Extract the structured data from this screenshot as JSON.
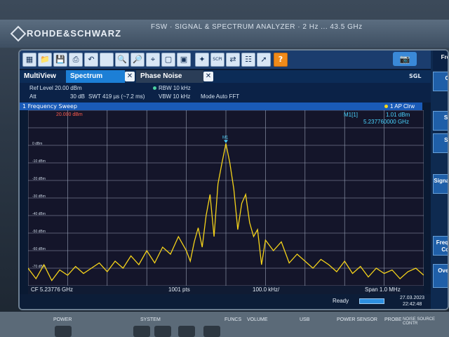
{
  "instrument": {
    "brand": "ROHDE&SCHWARZ",
    "model_line": "FSW · SIGNAL & SPECTRUM ANALYZER · 2 Hz ... 43.5 GHz"
  },
  "toolbar": {
    "buttons": [
      "windows-icon",
      "open-icon",
      "save-icon",
      "print-icon",
      "undo-icon",
      "blank-icon",
      "zoom-icon",
      "zoom-multi-icon",
      "zoom-out-icon",
      "display-icon",
      "window-icon",
      "transducer-icon",
      "scpi-icon",
      "sequencer-icon",
      "marker-table-icon",
      "help-pointer-icon",
      "help-icon"
    ],
    "scpi_label": "SCPI",
    "help_label": "?"
  },
  "tabs": [
    {
      "label": "MultiView"
    },
    {
      "label": "Spectrum"
    },
    {
      "label": "Phase Noise"
    }
  ],
  "sgl": "SGL",
  "settings": {
    "ref_level": "Ref Level 20.00 dBm",
    "att_label": "Att",
    "att_value": "30 dB",
    "swt": "SWT",
    "swt_value": "419 µs (~7.2 ms)",
    "rbw": "RBW",
    "rbw_value": "10 kHz",
    "vbw": "VBW",
    "vbw_value": "10 kHz",
    "mode": "Mode",
    "mode_value": "Auto FFT",
    "trace": "1 AP Clrw"
  },
  "sweep": {
    "title": "1 Frequency Sweep"
  },
  "marker": {
    "label": "M1[1]",
    "level": "1.01 dBm",
    "freq": "5.237760000 GHz",
    "tag": "M1"
  },
  "ref_line_label": "20.000 dBm",
  "y_tick_labels": [
    "0 dBm",
    "-10 dBm",
    "-20 dBm",
    "-30 dBm",
    "-40 dBm",
    "-50 dBm",
    "-60 dBm",
    "-70 dBm"
  ],
  "bottom": {
    "cf": "CF 5.23776 GHz",
    "pts": "1001 pts",
    "div": "100.0 kHz/",
    "span": "Span 1.0 MHz"
  },
  "status": {
    "ready": "Ready",
    "date": "27.03.2023",
    "time": "22:42:48"
  },
  "softkeys": [
    {
      "label": "Freque"
    },
    {
      "label": "Cen"
    },
    {
      "label": "Start"
    },
    {
      "label": "Stop"
    },
    {
      "label": "Signal Track"
    },
    {
      "label": "Frequency Config"
    },
    {
      "label": "Overview"
    }
  ],
  "panel": {
    "labels": [
      "POWER",
      "SYSTEM",
      "FUNCS",
      "VOLUME",
      "USB",
      "POWER SENSOR",
      "PROBE",
      "NOISE SOURCE CONTR"
    ]
  },
  "chart_data": {
    "type": "line",
    "xlabel": "",
    "ylabel": "",
    "x_unit": "MHz offset from CF",
    "xlim": [
      -0.5,
      0.5
    ],
    "ylim": [
      -80,
      20
    ],
    "grid": true,
    "series": [
      {
        "color": "#f5d31a",
        "x": [
          -0.5,
          -0.48,
          -0.46,
          -0.44,
          -0.42,
          -0.4,
          -0.38,
          -0.36,
          -0.34,
          -0.32,
          -0.3,
          -0.28,
          -0.26,
          -0.24,
          -0.22,
          -0.2,
          -0.18,
          -0.16,
          -0.14,
          -0.12,
          -0.1,
          -0.09,
          -0.08,
          -0.07,
          -0.06,
          -0.05,
          -0.04,
          -0.03,
          -0.02,
          -0.01,
          0.0,
          0.01,
          0.02,
          0.03,
          0.04,
          0.05,
          0.06,
          0.07,
          0.08,
          0.09,
          0.1,
          0.12,
          0.14,
          0.16,
          0.18,
          0.2,
          0.22,
          0.24,
          0.26,
          0.28,
          0.3,
          0.32,
          0.34,
          0.36,
          0.38,
          0.4,
          0.42,
          0.44,
          0.46,
          0.48,
          0.5
        ],
        "y": [
          -70,
          -76,
          -68,
          -77,
          -71,
          -74,
          -69,
          -73,
          -70,
          -67,
          -72,
          -66,
          -70,
          -63,
          -68,
          -60,
          -67,
          -58,
          -62,
          -52,
          -60,
          -66,
          -55,
          -47,
          -58,
          -40,
          -28,
          -52,
          -22,
          -10,
          1,
          -10,
          -25,
          -48,
          -33,
          -28,
          -44,
          -52,
          -48,
          -68,
          -54,
          -60,
          -55,
          -67,
          -62,
          -66,
          -70,
          -65,
          -68,
          -72,
          -66,
          -73,
          -69,
          -75,
          -70,
          -73,
          -71,
          -76,
          -72,
          -70,
          -74
        ]
      }
    ]
  }
}
